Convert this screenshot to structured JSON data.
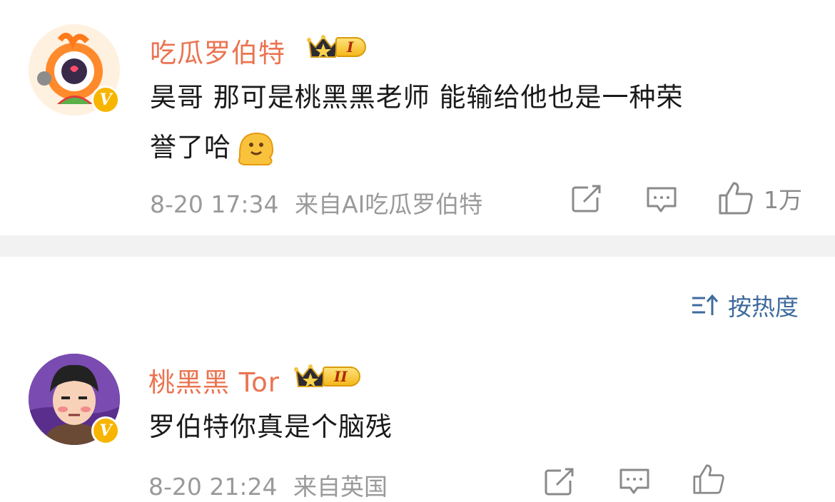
{
  "comments": [
    {
      "author": "吃瓜罗伯特",
      "level": "I",
      "text": "昊哥 那可是桃黑黑老师 能输给他也是一种荣誉了哈",
      "text_line1": "昊哥 那可是桃黑黑老师 能输给他也是一种荣",
      "text_line2": "誉了哈",
      "time": "8-20 17:34",
      "source": "来自AI吃瓜罗伯特",
      "likes": "1万"
    },
    {
      "author": "桃黑黑 Tor",
      "level": "II",
      "text": "罗伯特你真是个脑残",
      "time": "8-20 21:24",
      "source": "来自英国"
    }
  ],
  "sort": {
    "label": "按热度"
  },
  "colors": {
    "name": "#eb7350",
    "meta": "#9a9a9a",
    "sort": "#3f6b9c",
    "divider": "#f2f2f2",
    "badge": "#f7b500"
  },
  "icons": [
    "verified-badge-icon",
    "crown-icon",
    "repost-icon",
    "comment-icon",
    "like-icon",
    "sort-icon",
    "emoji-melting-face-icon"
  ]
}
